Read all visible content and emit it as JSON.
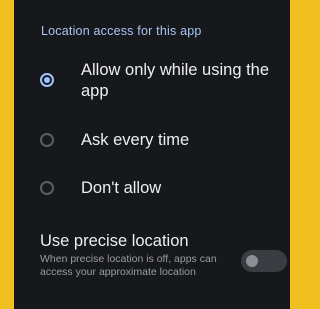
{
  "section_title": "Location access for this app",
  "options": [
    {
      "label": "Allow only while using the app",
      "selected": true
    },
    {
      "label": "Ask every time",
      "selected": false
    },
    {
      "label": "Don't allow",
      "selected": false
    }
  ],
  "precise_location": {
    "title": "Use precise location",
    "description": "When precise location is off, apps can access your approximate location",
    "enabled": false
  },
  "colors": {
    "frame": "#f2c01e",
    "panel": "#17181c",
    "accent": "#9ec2ff",
    "section_title": "#a9c5f5"
  }
}
